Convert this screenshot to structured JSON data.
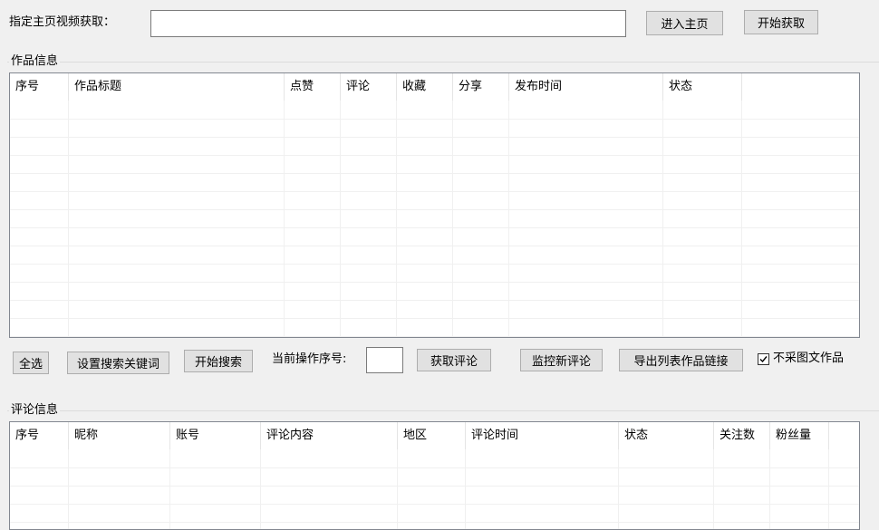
{
  "top_bar": {
    "label": "指定主页视频获取：",
    "url_value": "",
    "enter_homepage_button": "进入主页",
    "start_fetch_button": "开始获取"
  },
  "works_group": {
    "title": "作品信息",
    "columns": [
      "序号",
      "作品标题",
      "点赞",
      "评论",
      "收藏",
      "分享",
      "发布时间",
      "状态"
    ],
    "rows": []
  },
  "action_bar": {
    "select_all_button": "全选",
    "set_keywords_button": "设置搜索关键词",
    "start_search_button": "开始搜索",
    "current_index_label": "当前操作序号:",
    "current_index_value": "",
    "fetch_comments_button": "获取评论",
    "monitor_comments_button": "监控新评论",
    "export_links_button": "导出列表作品链接",
    "skip_image_posts_label": "不采图文作品",
    "skip_image_posts_checked": true
  },
  "comments_group": {
    "title": "评论信息",
    "columns": [
      "序号",
      "昵称",
      "账号",
      "评论内容",
      "地区",
      "评论时间",
      "状态",
      "关注数",
      "粉丝量"
    ],
    "rows": []
  }
}
